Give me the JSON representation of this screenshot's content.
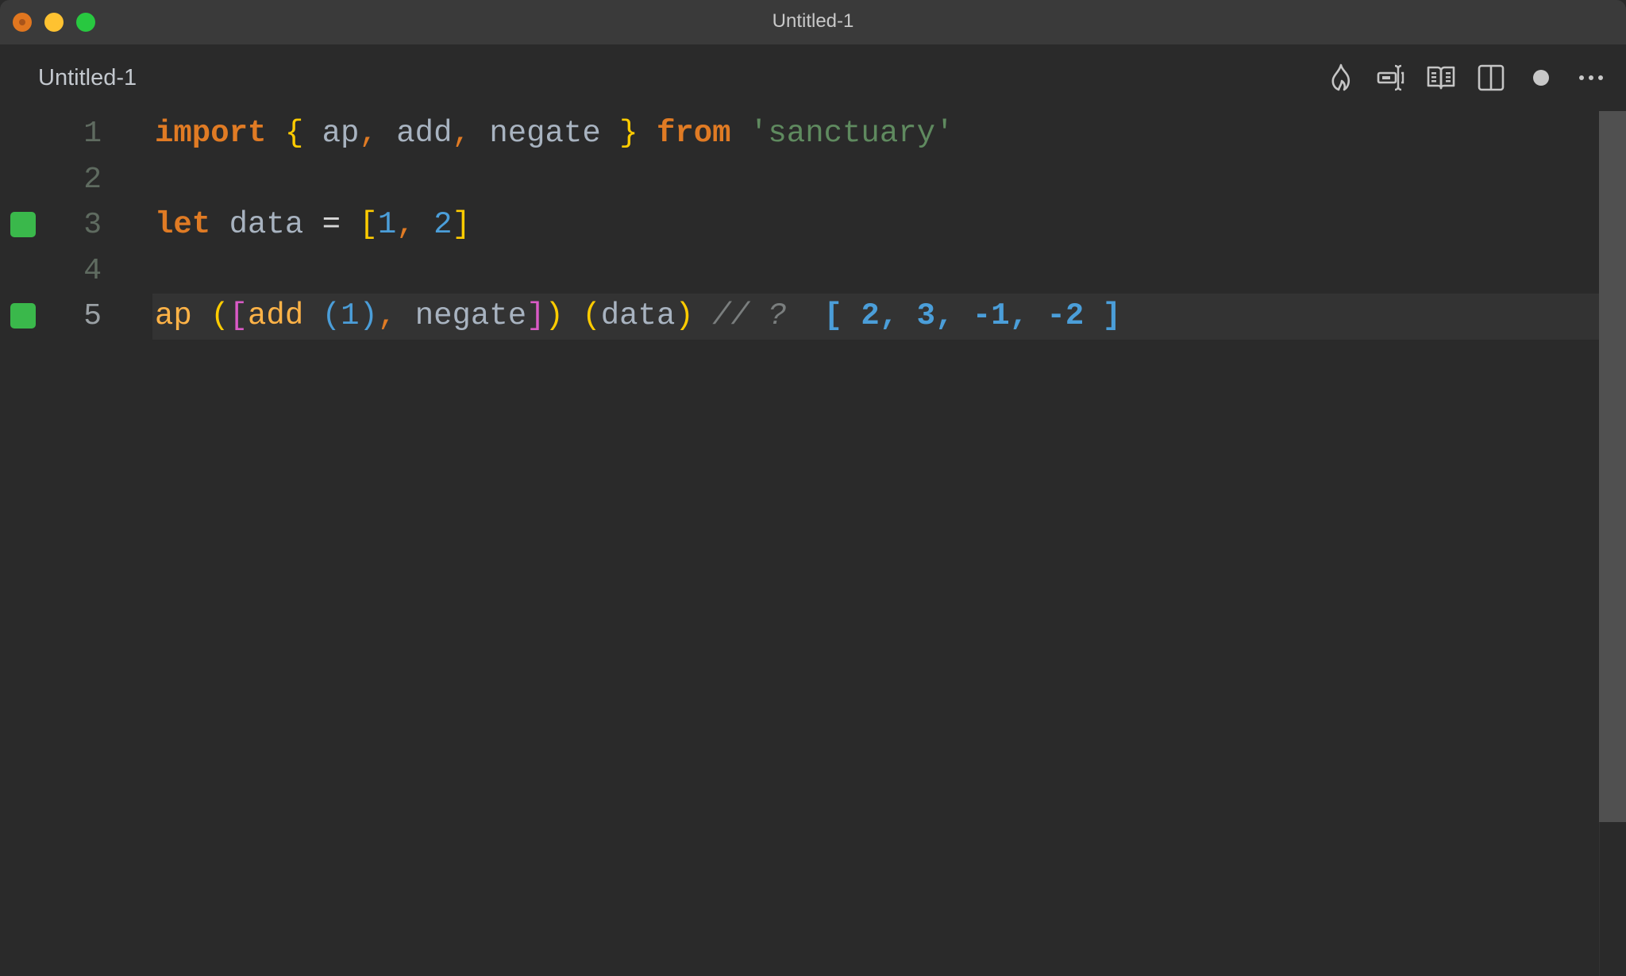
{
  "window": {
    "title": "Untitled-1",
    "traffic_lights": [
      "close",
      "minimize",
      "maximize"
    ]
  },
  "tab": {
    "title": "Untitled-1",
    "actions": [
      {
        "name": "flame-icon",
        "label": "Quokka: Start on current file"
      },
      {
        "name": "text-cursor-input-icon",
        "label": "Value explorer"
      },
      {
        "name": "open-book-icon",
        "label": "Open preview"
      },
      {
        "name": "split-editor-icon",
        "label": "Split editor"
      },
      {
        "name": "unsaved-dot-icon",
        "label": "Unsaved changes"
      },
      {
        "name": "more-actions-icon",
        "label": "More actions"
      }
    ]
  },
  "editor": {
    "current_line": 5,
    "lines": [
      {
        "number": "1",
        "marker": false
      },
      {
        "number": "2",
        "marker": false
      },
      {
        "number": "3",
        "marker": true
      },
      {
        "number": "4",
        "marker": false
      },
      {
        "number": "5",
        "marker": true
      }
    ],
    "code": {
      "line1": {
        "kw_import": "import",
        "open_brace": "{",
        "ident_ap": "ap",
        "comma1": ",",
        "ident_add": "add",
        "comma2": ",",
        "ident_negate": "negate",
        "close_brace": "}",
        "kw_from": "from",
        "module": "'sanctuary'"
      },
      "line3": {
        "kw_let": "let",
        "ident_data": "data",
        "op_eq": "=",
        "open_bracket": "[",
        "num1": "1",
        "comma": ",",
        "num2": "2",
        "close_bracket": "]"
      },
      "line5": {
        "fn_ap": "ap",
        "paren1_open": "(",
        "bracket_open": "[",
        "fn_add": "add",
        "paren2_open": "(",
        "num1": "1",
        "paren2_close": ")",
        "comma": ",",
        "ident_negate": "negate",
        "bracket_close": "]",
        "paren1_close": ")",
        "paren3_open": "(",
        "ident_data": "data",
        "paren3_close": ")",
        "comment": "// ?",
        "inline_result": "[ 2, 3, -1, -2 ]"
      }
    }
  },
  "colors": {
    "marker_green": "#3ab84b",
    "keyword_orange": "#e07b24",
    "bracket_yellow": "#ffcc00",
    "bracket_magenta": "#da5ac6",
    "number_blue": "#4b9ed9",
    "string_green": "#5f8a5f",
    "comment_grey": "#7a7e7e"
  }
}
